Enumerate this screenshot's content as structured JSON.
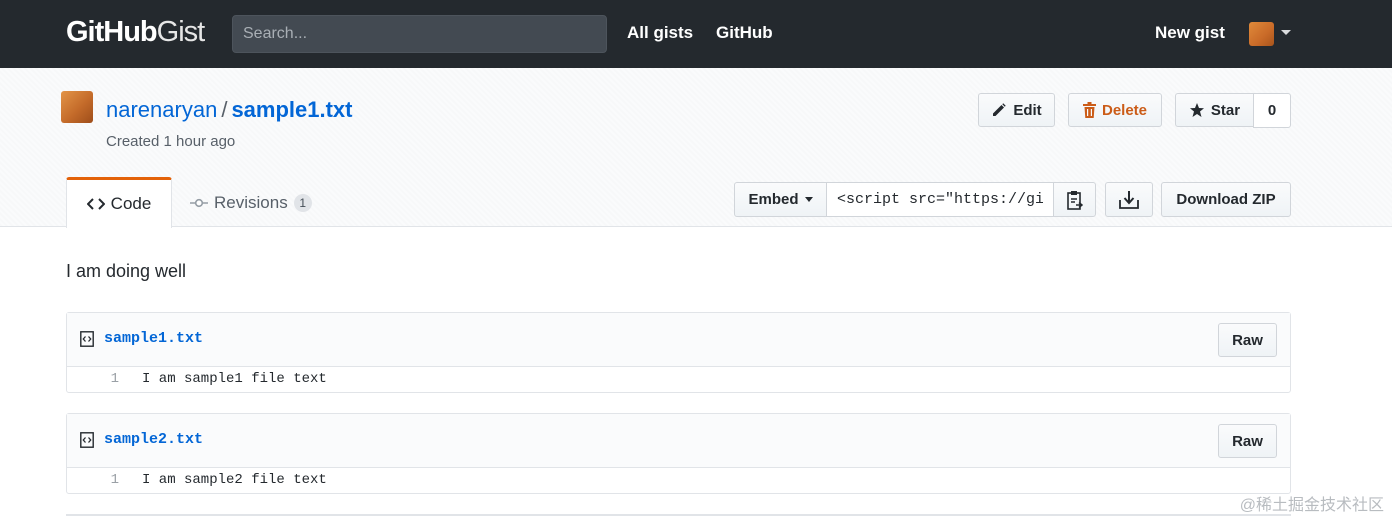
{
  "header": {
    "logo_bold": "GitHub",
    "logo_light": "Gist",
    "search_placeholder": "Search...",
    "nav": [
      "All gists",
      "GitHub"
    ],
    "new_gist": "New gist"
  },
  "gist": {
    "owner": "narenaryan",
    "separator": "/",
    "filename": "sample1.txt",
    "created": "Created 1 hour ago",
    "edit_label": "Edit",
    "delete_label": "Delete",
    "star_label": "Star",
    "star_count": "0"
  },
  "tabs": {
    "code_label": "Code",
    "revisions_label": "Revisions",
    "revisions_count": "1"
  },
  "embed": {
    "label": "Embed",
    "value": "<script src=\"https://gi",
    "download_zip": "Download ZIP"
  },
  "description": "I am doing well",
  "files": [
    {
      "name": "sample1.txt",
      "raw_label": "Raw",
      "lines": [
        {
          "n": "1",
          "text": "I am sample1 file text"
        }
      ]
    },
    {
      "name": "sample2.txt",
      "raw_label": "Raw",
      "lines": [
        {
          "n": "1",
          "text": "I am sample2 file text"
        }
      ]
    }
  ],
  "watermark": "@稀土掘金技术社区",
  "colors": {
    "accent": "#0366d6",
    "topbar": "#24292e",
    "tab_active": "#e36209",
    "delete": "#cb5c18"
  }
}
